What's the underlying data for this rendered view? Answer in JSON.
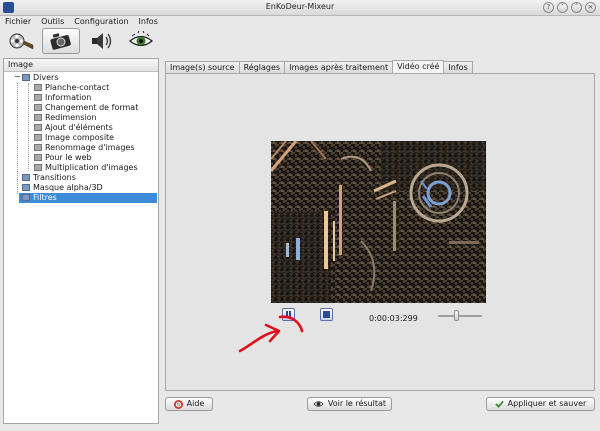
{
  "window": {
    "title": "EnKoDeur-Mixeur"
  },
  "menu": {
    "items": [
      "Fichier",
      "Outils",
      "Configuration",
      "Infos"
    ]
  },
  "toolbar": {
    "buttons": [
      {
        "icon": "film-reel-icon",
        "active": false
      },
      {
        "icon": "camera-icon",
        "active": true
      },
      {
        "icon": "speaker-icon",
        "active": false
      },
      {
        "icon": "eye-icon",
        "active": false
      }
    ]
  },
  "tree": {
    "header": "Image",
    "toggle_symbol": "−",
    "items": [
      {
        "label": "Divers",
        "level": 0,
        "folder": true,
        "expanded": true
      },
      {
        "label": "Planche-contact",
        "level": 1
      },
      {
        "label": "Information",
        "level": 1
      },
      {
        "label": "Changement de format",
        "level": 1
      },
      {
        "label": "Redimension",
        "level": 1
      },
      {
        "label": "Ajout d'éléments",
        "level": 1
      },
      {
        "label": "Image composite",
        "level": 1
      },
      {
        "label": "Renommage d'images",
        "level": 1
      },
      {
        "label": "Pour le web",
        "level": 1
      },
      {
        "label": "Multiplication d'images",
        "level": 1
      },
      {
        "label": "Transitions",
        "level": 0,
        "folder": true
      },
      {
        "label": "Masque alpha/3D",
        "level": 0,
        "folder": true
      },
      {
        "label": "Filtres",
        "level": 0,
        "folder": true,
        "selected": true
      }
    ]
  },
  "tabs": [
    "Image(s) source",
    "Réglages",
    "Images après traitement",
    "Vidéo créé",
    "Infos"
  ],
  "active_tab": 3,
  "player": {
    "time": "0:00:03:299",
    "position_fraction": 0.43
  },
  "buttons": {
    "help": "Aide",
    "view_result": "Voir le résultat",
    "apply_save": "Appliquer et sauver"
  },
  "colors": {
    "selection": "#3d8ad6",
    "annotation": "#e0101a"
  }
}
